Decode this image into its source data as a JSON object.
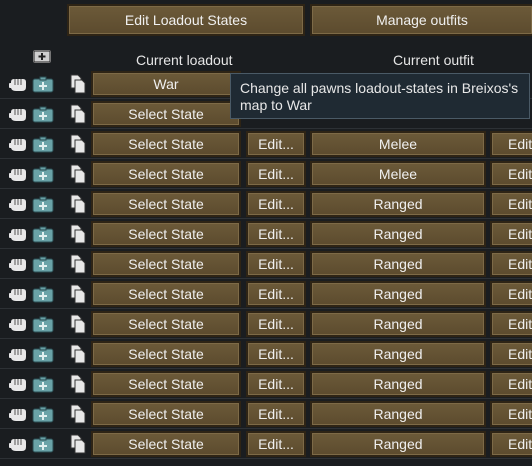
{
  "header": {
    "edit_loadout_states": "Edit Loadout States",
    "manage_outfits": "Manage outfits",
    "current_loadout": "Current loadout",
    "current_outfit": "Current outfit"
  },
  "tooltip": {
    "text": "Change all pawns loadout-states in Breixos's map to War"
  },
  "rows": [
    {
      "state": "War",
      "edit": "",
      "outfit": "",
      "edit2": ""
    },
    {
      "state": "Select State",
      "edit": "",
      "outfit": "",
      "edit2": ""
    },
    {
      "state": "Select State",
      "edit": "Edit...",
      "outfit": "Melee",
      "edit2": "Edit..."
    },
    {
      "state": "Select State",
      "edit": "Edit...",
      "outfit": "Melee",
      "edit2": "Edit..."
    },
    {
      "state": "Select State",
      "edit": "Edit...",
      "outfit": "Ranged",
      "edit2": "Edit..."
    },
    {
      "state": "Select State",
      "edit": "Edit...",
      "outfit": "Ranged",
      "edit2": "Edit..."
    },
    {
      "state": "Select State",
      "edit": "Edit...",
      "outfit": "Ranged",
      "edit2": "Edit..."
    },
    {
      "state": "Select State",
      "edit": "Edit...",
      "outfit": "Ranged",
      "edit2": "Edit..."
    },
    {
      "state": "Select State",
      "edit": "Edit...",
      "outfit": "Ranged",
      "edit2": "Edit..."
    },
    {
      "state": "Select State",
      "edit": "Edit...",
      "outfit": "Ranged",
      "edit2": "Edit..."
    },
    {
      "state": "Select State",
      "edit": "Edit...",
      "outfit": "Ranged",
      "edit2": "Edit..."
    },
    {
      "state": "Select State",
      "edit": "Edit...",
      "outfit": "Ranged",
      "edit2": "Edit..."
    },
    {
      "state": "Select State",
      "edit": "Edit...",
      "outfit": "Ranged",
      "edit2": "Edit..."
    }
  ]
}
